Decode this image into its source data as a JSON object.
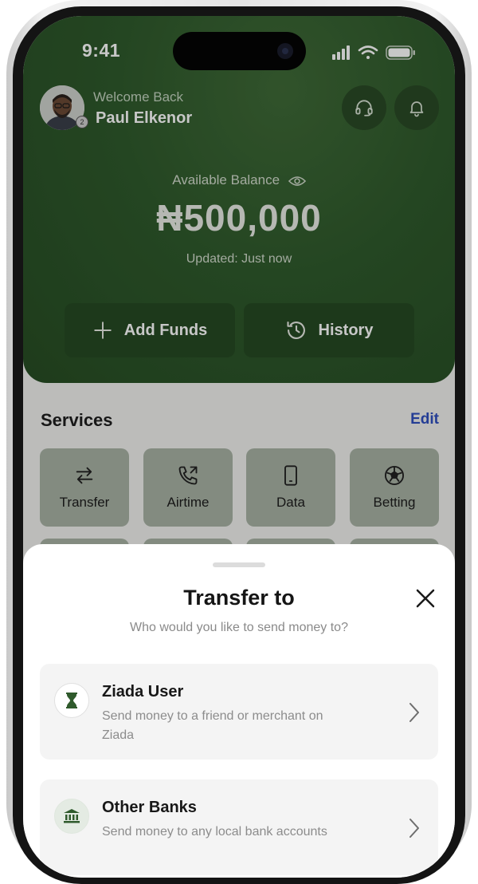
{
  "status_bar": {
    "time": "9:41"
  },
  "header": {
    "greeting": "Welcome Back",
    "user_name": "Paul Elkenor",
    "avatar_badge": "2"
  },
  "balance": {
    "label": "Available Balance",
    "amount": "₦500,000",
    "updated": "Updated: Just now"
  },
  "actions": {
    "add_funds": "Add Funds",
    "history": "History"
  },
  "services": {
    "title": "Services",
    "edit": "Edit",
    "items": [
      {
        "label": "Transfer",
        "icon": "transfer-arrows-icon"
      },
      {
        "label": "Airtime",
        "icon": "phone-call-icon"
      },
      {
        "label": "Data",
        "icon": "mobile-device-icon"
      },
      {
        "label": "Betting",
        "icon": "soccer-ball-icon"
      }
    ]
  },
  "transfer_sheet": {
    "title": "Transfer to",
    "subtitle": "Who would you like to send money to?",
    "options": [
      {
        "title": "Ziada User",
        "description": "Send money to a friend or merchant on Ziada",
        "icon": "hourglass-icon"
      },
      {
        "title": "Other Banks",
        "description": "Send money to any local bank accounts",
        "icon": "bank-icon"
      }
    ]
  },
  "colors": {
    "brand_green": "#2f5a2c",
    "accent_blue": "#2f4fbf",
    "sheet_background": "#ffffff"
  }
}
